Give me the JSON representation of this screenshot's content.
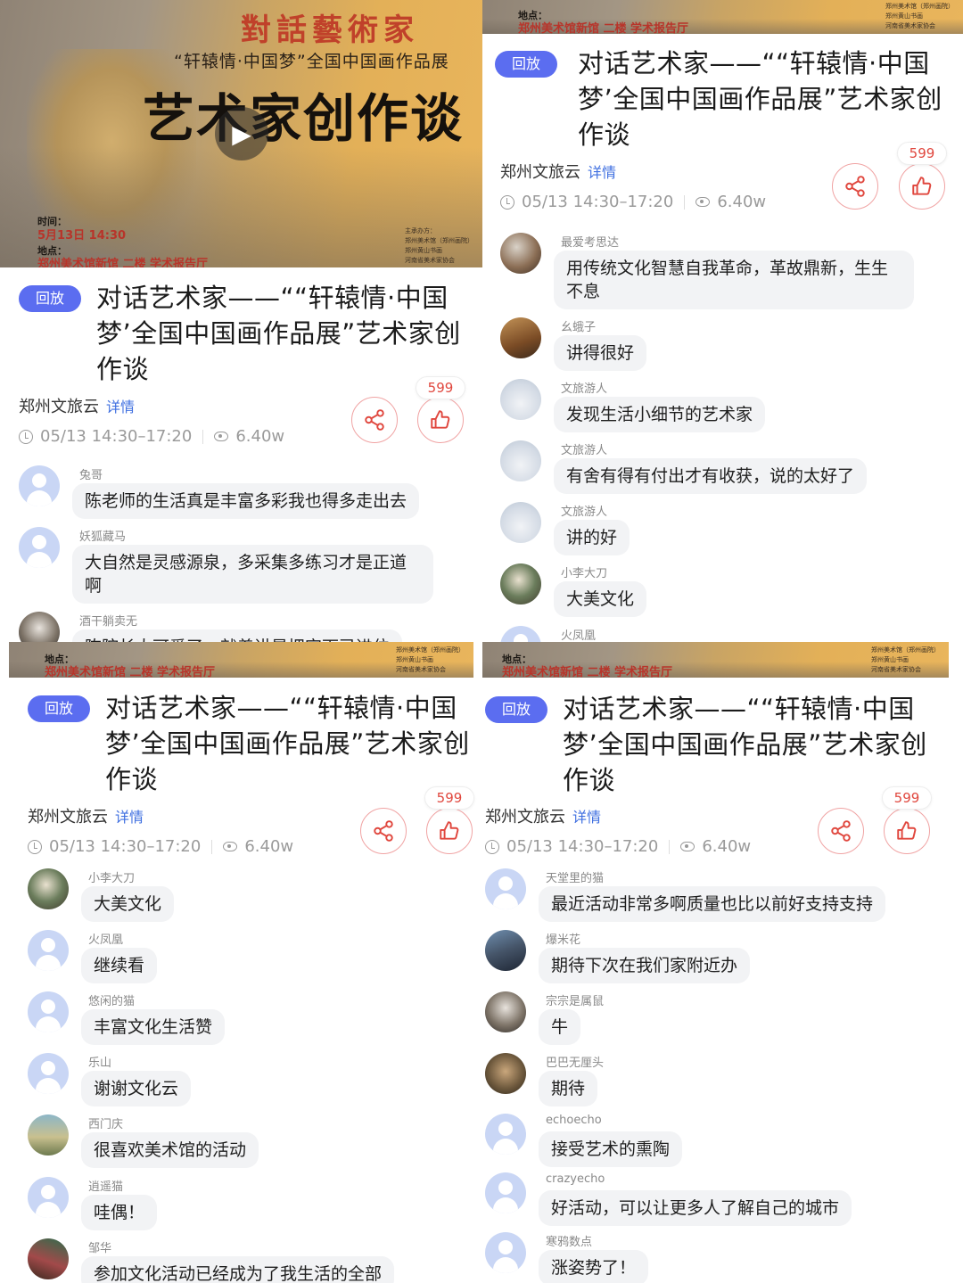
{
  "poster": {
    "calligraphy": "對話藝術家",
    "subtitle": "“轩辕情·中国梦”全国中国画作品展",
    "big_title": "艺术家创作谈",
    "time_label": "时间：",
    "time_value": "5月13日 14:30",
    "place_label": "地点：",
    "place_value": "郑州美术馆新馆 二楼 学术报告厅",
    "org_lines": [
      "主承办方：",
      "郑州美术馆（郑州画院）",
      "郑州黄山书画",
      "河南省美术家协会"
    ]
  },
  "post": {
    "badge": "回放",
    "title": "对话艺术家——““轩辕情·中国梦’全国中国画作品展”艺术家创作谈",
    "source": "郑州文旅云",
    "detail_link": "详情",
    "time_range": "05/13 14:30–17:20",
    "views": "6.40w",
    "like_count": "599"
  },
  "panels": [
    {
      "comments": [
        {
          "name": "兔哥",
          "text": "陈老师的生活真是丰富多彩我也得多走出去",
          "avatar": "default"
        },
        {
          "name": "妖狐藏马",
          "text": "大自然是灵感源泉，多采集多练习才是正道啊",
          "avatar": "default"
        },
        {
          "name": "酒干躺卖无",
          "text": "陈院长太可爱了，就着讲是把字下已进位",
          "avatar": "photo-g"
        }
      ]
    },
    {
      "comments": [
        {
          "name": "最爱考思达",
          "text": "用传统文化智慧自我革命，革故鼎新，生生不息",
          "avatar": "photo-a"
        },
        {
          "name": "幺蛾子",
          "text": "讲得很好",
          "avatar": "photo-b"
        },
        {
          "name": "文旅游人",
          "text": "发现生活小细节的艺术家",
          "avatar": "photo-c"
        },
        {
          "name": "文旅游人",
          "text": "有舍有得有付出才有收获，说的太好了",
          "avatar": "photo-c"
        },
        {
          "name": "文旅游人",
          "text": "讲的好",
          "avatar": "photo-c"
        },
        {
          "name": "小李大刀",
          "text": "大美文化",
          "avatar": "photo-d"
        },
        {
          "name": "火凤凰",
          "text": "",
          "avatar": "default"
        }
      ]
    },
    {
      "comments": [
        {
          "name": "小李大刀",
          "text": "大美文化",
          "avatar": "photo-d"
        },
        {
          "name": "火凤凰",
          "text": "继续看",
          "avatar": "default"
        },
        {
          "name": "悠闲的猫",
          "text": "丰富文化生活赞",
          "avatar": "default"
        },
        {
          "name": "乐山",
          "text": "谢谢文化云",
          "avatar": "default"
        },
        {
          "name": "西门庆",
          "text": "很喜欢美术馆的活动",
          "avatar": "photo-i"
        },
        {
          "name": "逍遥猫",
          "text": "哇偶！",
          "avatar": "default"
        },
        {
          "name": "邹华",
          "text": "参加文化活动已经成为了我生活的全部",
          "avatar": "photo-j"
        }
      ]
    },
    {
      "comments": [
        {
          "name": "天堂里的猫",
          "text": "最近活动非常多啊质量也比以前好支持支持",
          "avatar": "default"
        },
        {
          "name": "爆米花",
          "text": "期待下次在我们家附近办",
          "avatar": "photo-f"
        },
        {
          "name": "宗宗是属鼠",
          "text": "牛",
          "avatar": "photo-g"
        },
        {
          "name": "巴巴无厘头",
          "text": "期待",
          "avatar": "photo-h"
        },
        {
          "name": "echoecho",
          "text": "接受艺术的熏陶",
          "avatar": "default"
        },
        {
          "name": "crazyecho",
          "text": "好活动，可以让更多人了解自己的城市",
          "avatar": "default"
        },
        {
          "name": "寒鸦数点",
          "text": "涨姿势了！",
          "avatar": "default"
        }
      ]
    }
  ],
  "icons": {
    "share": "share-icon",
    "like": "thumbs-up-icon",
    "clock": "clock-icon",
    "views": "eye-icon",
    "play": "play-icon"
  },
  "colors": {
    "badge": "#5b6df0",
    "detail_link": "#3f6fe0",
    "like_accent": "#e0473e",
    "bubble_bg": "#f2f3f5"
  }
}
